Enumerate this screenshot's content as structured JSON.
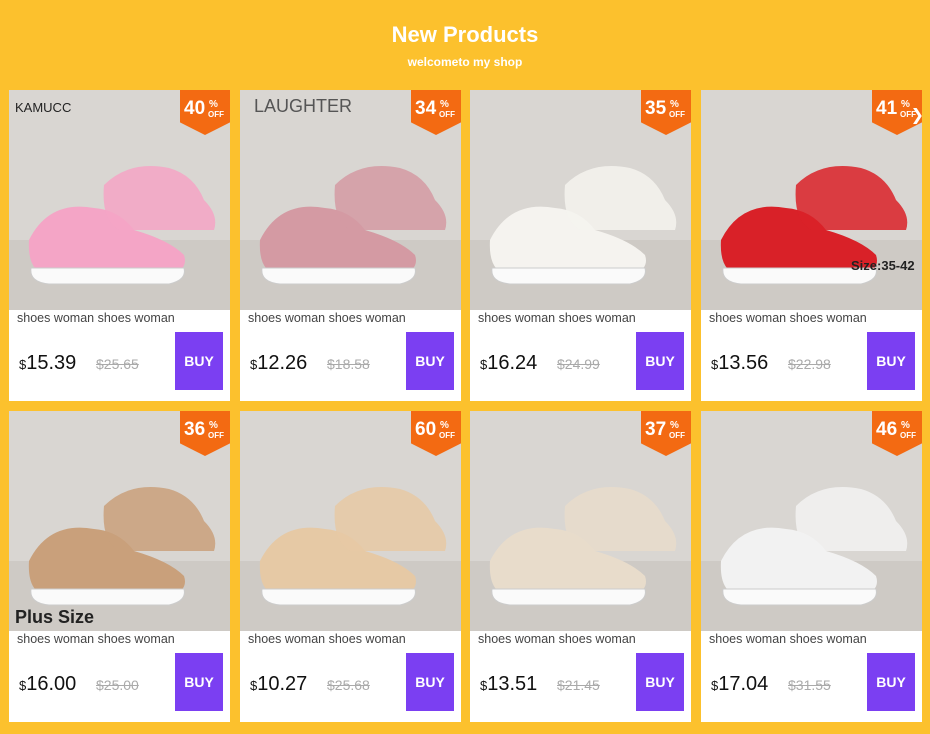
{
  "header": {
    "title": "New Products",
    "subtitle": "welcometo my shop"
  },
  "products": [
    {
      "discount": "40",
      "pct": "%",
      "off": "OFF",
      "title": "shoes woman shoes woman",
      "currency": "$",
      "price": "15.39",
      "old_price": "$25.65",
      "buy": "BUY",
      "image_text": "KAMUCC",
      "shoe_color": "#f4a5c6"
    },
    {
      "discount": "34",
      "pct": "%",
      "off": "OFF",
      "title": "shoes woman shoes woman",
      "currency": "$",
      "price": "12.26",
      "old_price": "$18.58",
      "buy": "BUY",
      "image_text": "LAUGHTER",
      "shoe_color": "#d49aa3"
    },
    {
      "discount": "35",
      "pct": "%",
      "off": "OFF",
      "title": "shoes woman shoes woman",
      "currency": "$",
      "price": "16.24",
      "old_price": "$24.99",
      "buy": "BUY",
      "image_text": "",
      "shoe_color": "#f5f3ef"
    },
    {
      "discount": "41",
      "pct": "%",
      "off": "OFF",
      "title": "shoes woman shoes woman",
      "currency": "$",
      "price": "13.56",
      "old_price": "$22.98",
      "buy": "BUY",
      "image_text": "Size:35-42",
      "shoe_color": "#d92128"
    },
    {
      "discount": "36",
      "pct": "%",
      "off": "OFF",
      "title": "shoes woman shoes woman",
      "currency": "$",
      "price": "16.00",
      "old_price": "$25.00",
      "buy": "BUY",
      "image_text": "Plus Size",
      "shoe_color": "#c9a07b"
    },
    {
      "discount": "60",
      "pct": "%",
      "off": "OFF",
      "title": "shoes woman shoes woman",
      "currency": "$",
      "price": "10.27",
      "old_price": "$25.68",
      "buy": "BUY",
      "image_text": "",
      "shoe_color": "#e6c9a5"
    },
    {
      "discount": "37",
      "pct": "%",
      "off": "OFF",
      "title": "shoes woman shoes woman",
      "currency": "$",
      "price": "13.51",
      "old_price": "$21.45",
      "buy": "BUY",
      "image_text": "",
      "shoe_color": "#e8dccb"
    },
    {
      "discount": "46",
      "pct": "%",
      "off": "OFF",
      "title": "shoes woman shoes woman",
      "currency": "$",
      "price": "17.04",
      "old_price": "$31.55",
      "buy": "BUY",
      "image_text": "",
      "shoe_color": "#f2f2f2"
    }
  ],
  "colors": {
    "background": "#fcc12d",
    "badge": "#f36a12",
    "buy_button": "#7b3ff2"
  },
  "icons": {
    "carousel_next": "chevron-right-icon"
  }
}
